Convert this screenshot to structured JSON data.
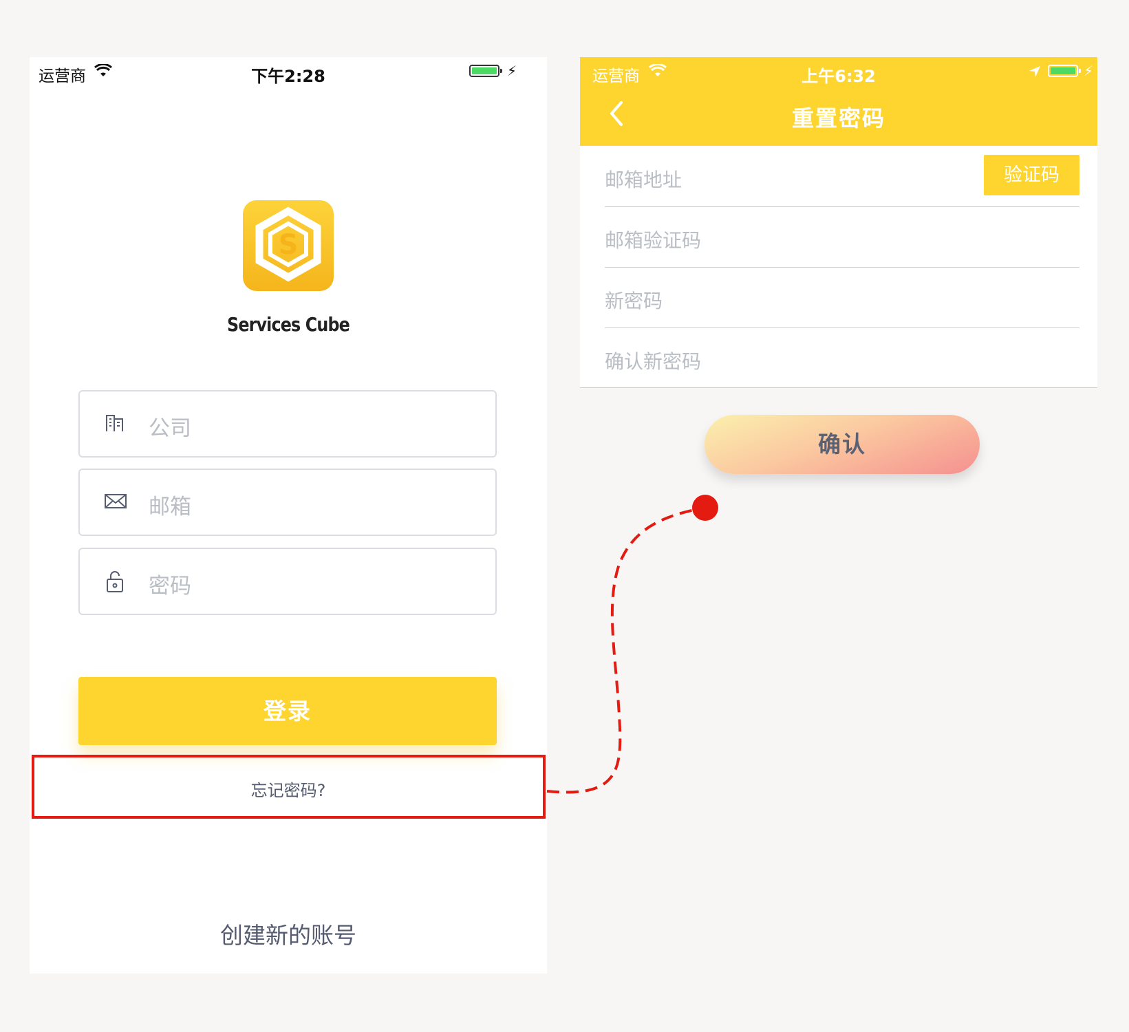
{
  "login_screen": {
    "status": {
      "carrier": "运营商",
      "time": "下午2:28"
    },
    "brand_name": "Services Cube",
    "fields": {
      "company_placeholder": "公司",
      "email_placeholder": "邮箱",
      "password_placeholder": "密码"
    },
    "login_label": "登录",
    "forgot_label": "忘记密码?",
    "create_account_label": "创建新的账号"
  },
  "reset_screen": {
    "status": {
      "carrier": "运营商",
      "time": "上午6:32"
    },
    "title": "重置密码",
    "fields": {
      "email_address": "邮箱地址",
      "email_code": "邮箱验证码",
      "new_password": "新密码",
      "confirm_password": "确认新密码"
    },
    "code_button_label": "验证码",
    "confirm_label": "确认"
  },
  "colors": {
    "accent": "#fdd52e",
    "annotation": "#e31b10",
    "text_muted": "#555c70",
    "placeholder": "#b9bdc4"
  }
}
